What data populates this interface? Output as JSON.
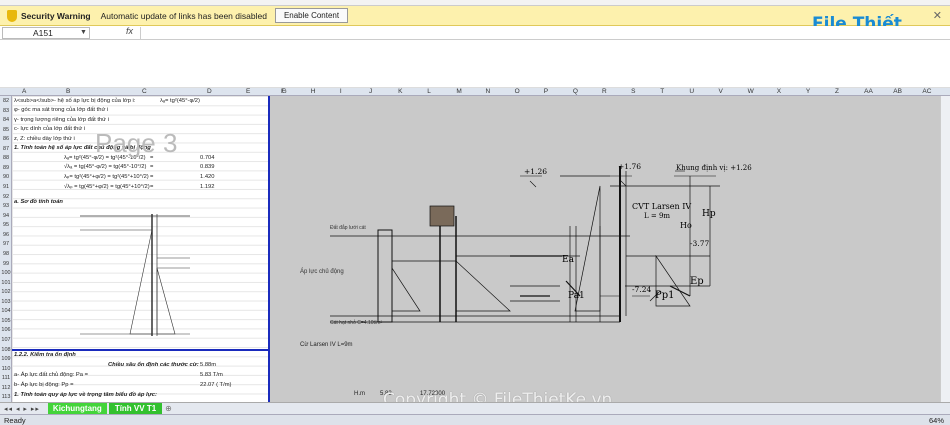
{
  "security": {
    "title": "Security Warning",
    "message": "Automatic update of links has been disabled",
    "button": "Enable Content"
  },
  "logo": "File Thiết Kế.vn",
  "formula_bar": {
    "cell_ref": "A151",
    "fx": "fx"
  },
  "columns_left": [
    "A",
    "B",
    "C",
    "D",
    "E",
    "F"
  ],
  "columns_right": [
    "G",
    "H",
    "I",
    "J",
    "K",
    "L",
    "M",
    "N",
    "O",
    "P",
    "Q",
    "R",
    "S",
    "T",
    "U",
    "V",
    "W",
    "X",
    "Y",
    "Z",
    "AA",
    "AB",
    "AC"
  ],
  "rows": [
    "82",
    "83",
    "84",
    "85",
    "86",
    "87",
    "88",
    "89",
    "90",
    "91",
    "92",
    "93",
    "94",
    "95",
    "96",
    "97",
    "98",
    "99",
    "100",
    "101",
    "102",
    "103",
    "104",
    "105",
    "106",
    "107",
    "108",
    "109",
    "110",
    "111",
    "112",
    "113"
  ],
  "sheet": {
    "r82": "λ<sub>a</sub>- hệ số áp lực bị động của lớp i:",
    "r82_formula": "λₐ= tg²(45°-φ/2)",
    "r83": "φ- góc ma sát trong của lớp đất thứ i",
    "r84": "γ- trọng lượng riêng của lớp đất thứ i",
    "r85": "c- lực dính của lớp đất thứ i",
    "r86": "z, Z: chiều dày lớp thứ i",
    "r87": "1. Tính toán hệ số áp lực đất chủ động và bị động",
    "f1": "λₐ= tg²(45°-φ/2) = tg²(45°-10°/2)",
    "f2": "√λₐ = tg(45°-φ/2) = tg(45°-10°/2)",
    "f3": "λₚ= tg²(45°+φ/2) = tg²(45°+10°/2)",
    "f4": "√λₚ = tg(45°+φ/2) = tg(45°+10°/2)",
    "eq": "=",
    "v1": "0.704",
    "v2": "0.839",
    "v3": "1.420",
    "v4": "1.192",
    "r92": "a. Sơ đồ tính toán",
    "page": "Page 3",
    "r107": "1.2.2. Kiểm tra ổn định",
    "r108": "Chiều sâu ổn định các thước cừ:",
    "r108v": "5.88m",
    "r109": "a- Áp lực đất chủ động: Pa =",
    "r109v": "5.83 T/m",
    "r110": "b- Áp lực bị động: Pp =",
    "r110v": "22.07 ( T/m)",
    "r111": "1. Tính toán quy áp lực về trọng tâm biểu đồ áp lực:"
  },
  "drawing": {
    "lev1": "+1.26",
    "lev2": "+1.76",
    "lev3": "Khung định vị: +1.26",
    "cvt": "CVT Larsen IV",
    "len": "L = 9m",
    "hp": "Hp",
    "ho": "Ho",
    "lev4": "-3.77",
    "ep": "Ep",
    "pp1": "Pp1",
    "lev5": "-7.24",
    "ea": "Ea",
    "pa1": "Pa1",
    "ap": "Áp lực chủ động",
    "cl": "Cừ Larsen IV L=9m",
    "l1": "Đất đắp lưới cát",
    "l2": "Cát hạt nhỏ C=4.10t/m²",
    "hm": "H.m",
    "v583": "5.83",
    "v1772": "17.72000"
  },
  "tabs": [
    "Kichungtang",
    "Tính VV T1"
  ],
  "status": {
    "ready": "Ready",
    "zoom": "64%"
  },
  "copyright": "Copyright © FileThietKe.vn"
}
